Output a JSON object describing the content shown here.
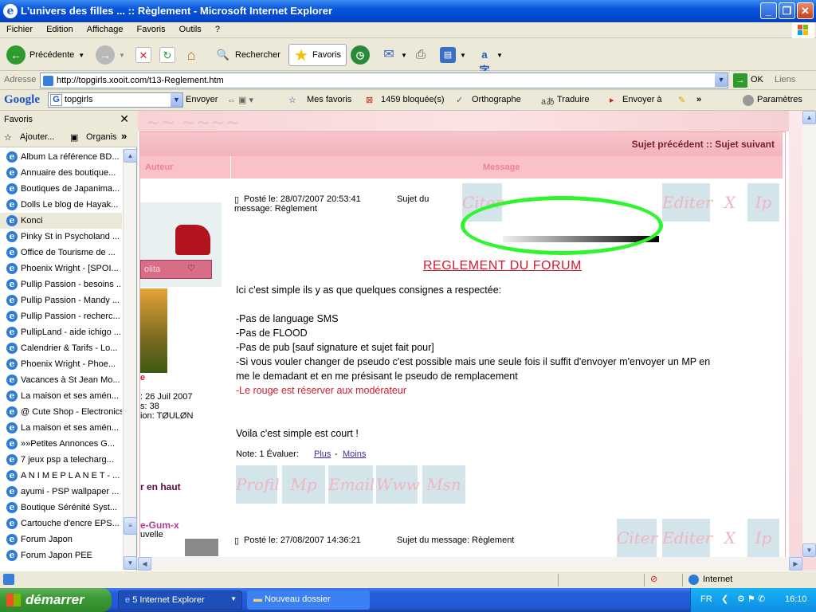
{
  "window": {
    "title": "L'univers des filles ... :: Règlement - Microsoft Internet Explorer"
  },
  "menu": [
    "Fichier",
    "Edition",
    "Affichage",
    "Favoris",
    "Outils",
    "?"
  ],
  "toolbar": {
    "back": "Précédente",
    "search": "Rechercher",
    "favorites": "Favoris"
  },
  "address": {
    "label": "Adresse",
    "url": "http://topgirls.xooit.com/t13-Reglement.htm",
    "go": "OK",
    "links": "Liens"
  },
  "google": {
    "logo": "Google",
    "query": "topgirls",
    "send": "Envoyer",
    "myfav": "Mes favoris",
    "blocked": "1459 bloquée(s)",
    "spell": "Orthographe",
    "translate": "Traduire",
    "sendto": "Envoyer à",
    "settings": "Paramètres"
  },
  "favorites": {
    "title": "Favoris",
    "add": "Ajouter...",
    "organize": "Organis",
    "items": [
      "Album  La référence BD...",
      "Annuaire des boutique...",
      "Boutiques de Japanima...",
      "Dolls Le blog de Hayak...",
      "Konci",
      "Pinky St in Psycholand ...",
      "Office de Tourisme de ...",
      "Phoenix Wright - [SPOI...",
      "Pullip Passion - besoins ...",
      "Pullip Passion - Mandy ...",
      "Pullip Passion - recherc...",
      "PullipLand - aide ichigo ...",
      "Calendrier & Tarifs - Lo...",
      "Phoenix Wright - Phoe...",
      "Vacances à St Jean Mo...",
      "La maison et ses amén...",
      "@ Cute Shop - Electronics",
      "La maison et ses amén...",
      "»»Petites Annonces G...",
      "7 jeux psp a telecharg...",
      "A N I M E P L A N E T - ...",
      "ayumi - PSP wallpaper ...",
      "Boutique Sérénité Syst...",
      "Cartouche d'encre EPS...",
      "Forum Japon",
      "Forum Japon PEE"
    ],
    "selected_index": 4
  },
  "forum": {
    "nav": "Sujet précédent :: Sujet suivant",
    "col_author": "Auteur",
    "col_message": "Message",
    "post1": {
      "meta_a": "Posté le: 28/07/2007 20:53:41",
      "meta_b": "Sujet du",
      "meta_c": "message: Règlement",
      "title": "REGLEMENT DU FORUM",
      "lines": [
        "Ici c'est simple ils y as que quelques consignes a respectée:",
        "-Pas de language SMS",
        "-Pas de FLOOD",
        "-Pas de pub [sauf signature et sujet fait pour]",
        "-Si vous vouler changer de pseudo c'est possible mais une seule fois il suffit d'envoyer m'envoyer un MP en",
        "me le demadant et en me présisant le pseudo de remplacement"
      ],
      "red_line": "-Le rouge est réserver aux modérateur",
      "closing": "Voila c'est simple est court !",
      "note_label": "Note: 1  Évaluer:",
      "plus": "Plus",
      "dash": "-",
      "moins": "Moins",
      "buttons_top": [
        "Citer",
        "Editer",
        "X",
        "Ip"
      ],
      "buttons_bottom": [
        "Profil",
        "Mp",
        "Email",
        "Www",
        "Msn"
      ]
    },
    "author1": {
      "badge": "olita",
      "joined": ": 26 Juil 2007",
      "posts": "s: 38",
      "location": "ion: TØULØN",
      "red_char": "e"
    },
    "back_top": "r en haut",
    "author2": {
      "name": "e-Gum-x",
      "status": "uvelle"
    },
    "post2": {
      "meta_a": "Posté le: 27/08/2007 14:36:21",
      "meta_b": "Sujet du message: Règlement",
      "buttons": [
        "Citer",
        "Editer",
        "X",
        "Ip"
      ]
    }
  },
  "status": {
    "zone": "Internet"
  },
  "taskbar": {
    "start": "démarrer",
    "task1": "5 Internet Explorer",
    "task2": "Nouveau dossier",
    "lang": "FR",
    "clock": "16:10"
  }
}
